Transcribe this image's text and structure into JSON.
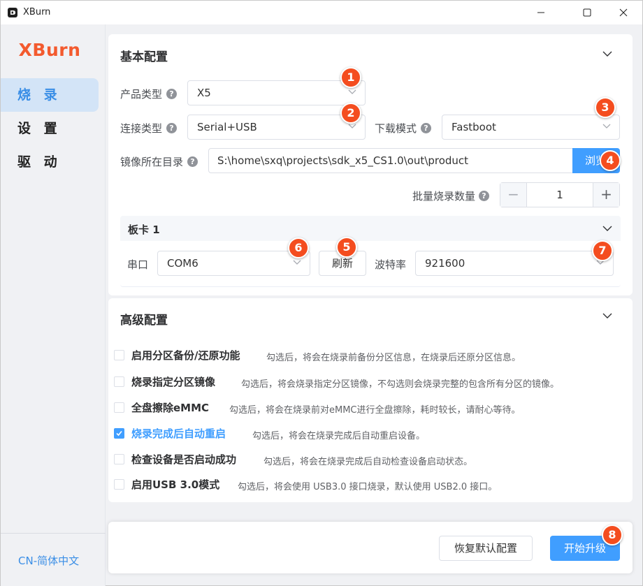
{
  "window": {
    "title": "XBurn"
  },
  "sidebar": {
    "brand": "XBurn",
    "items": [
      {
        "label": "烧 录",
        "active": true
      },
      {
        "label": "设 置",
        "active": false
      },
      {
        "label": "驱 动",
        "active": false
      }
    ],
    "language": "CN-简体中文"
  },
  "basic": {
    "title": "基本配置",
    "product_type": {
      "label": "产品类型",
      "value": "X5"
    },
    "connection_type": {
      "label": "连接类型",
      "value": "Serial+USB"
    },
    "download_mode": {
      "label": "下载模式",
      "value": "Fastboot"
    },
    "image_dir": {
      "label": "镜像所在目录",
      "value": "S:\\home\\sxq\\projects\\sdk_x5_CS1.0\\out\\product",
      "browse_label": "浏览"
    },
    "batch_count": {
      "label": "批量烧录数量",
      "value": "1",
      "minus": "−",
      "plus": "+"
    },
    "board": {
      "title": "板卡 1",
      "port_label": "串口",
      "port_value": "COM6",
      "refresh_label": "刷新",
      "baud_label": "波特率",
      "baud_value": "921600"
    }
  },
  "advanced": {
    "title": "高级配置",
    "options": [
      {
        "label": "启用分区备份/还原功能",
        "desc": "勾选后，将会在烧录前备份分区信息，在烧录后还原分区信息。",
        "checked": false
      },
      {
        "label": "烧录指定分区镜像",
        "desc": "勾选后，将会烧录指定分区镜像，不勾选则会烧录完整的包含所有分区的镜像。",
        "checked": false
      },
      {
        "label": "全盘擦除eMMC",
        "desc": "勾选后，将会在烧录前对eMMC进行全盘擦除，耗时较长，请耐心等待。",
        "checked": false
      },
      {
        "label": "烧录完成后自动重启",
        "desc": "勾选后，将会在烧录完成后自动重启设备。",
        "checked": true
      },
      {
        "label": "检查设备是否启动成功",
        "desc": "勾选后，将会在烧录完成后自动检查设备启动状态。",
        "checked": false
      },
      {
        "label": "启用USB 3.0模式",
        "desc": "勾选后，将会使用 USB3.0 接口烧录，默认使用 USB2.0 接口。",
        "checked": false
      }
    ]
  },
  "footer": {
    "reset_label": "恢复默认配置",
    "start_label": "开始升级"
  },
  "badges": [
    "1",
    "2",
    "3",
    "4",
    "5",
    "6",
    "7",
    "8"
  ],
  "help_glyph": "?",
  "colors": {
    "accent": "#409eff",
    "brand": "#f35a2e",
    "badge": "#f44d1f",
    "sidebar_active_bg": "#d3e4f7"
  }
}
